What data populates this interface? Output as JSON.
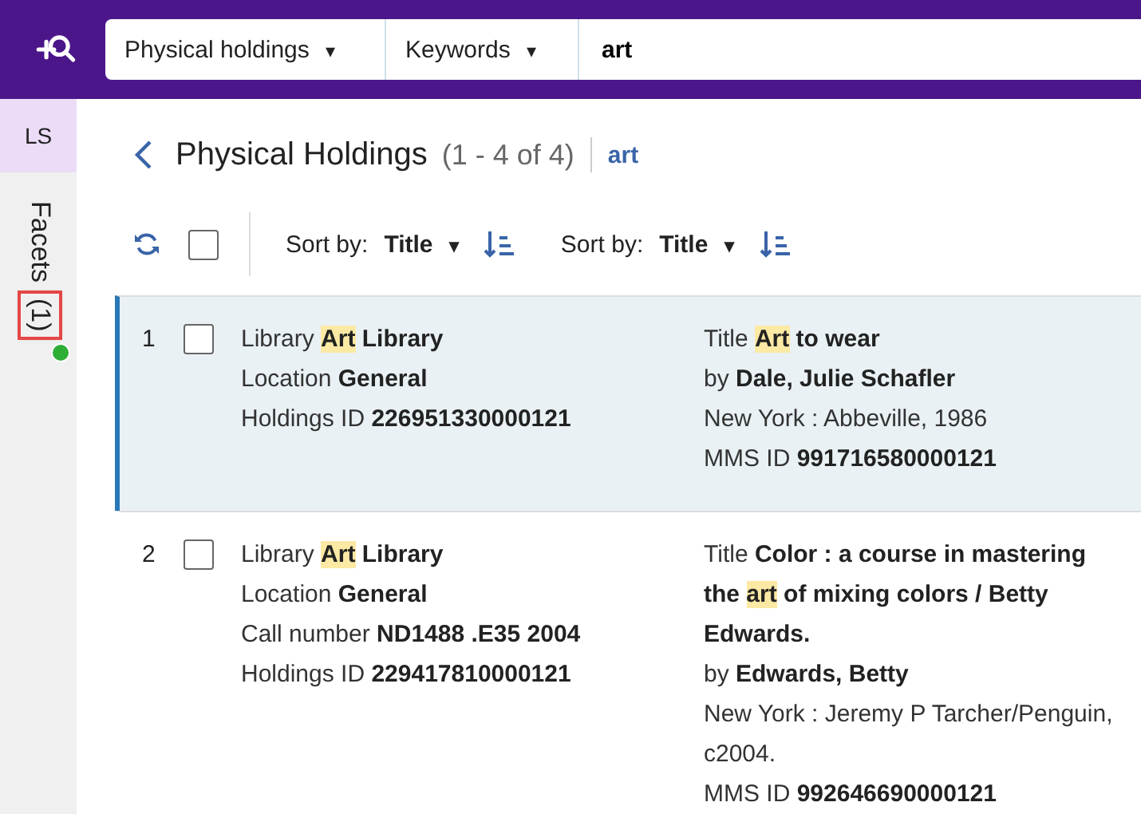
{
  "search_bar": {
    "scope": "Physical holdings",
    "scope_caret": "▾",
    "field": "Keywords",
    "field_caret": "▾",
    "query": "art"
  },
  "sidebar": {
    "tab": "LS",
    "facets": {
      "label": "Facets",
      "count": "(1)",
      "active": true,
      "highlighted": true
    }
  },
  "header": {
    "title": "Physical Holdings",
    "range": "(1 - 4 of 4)",
    "query": "art"
  },
  "toolbar": {
    "select_all": {
      "checked": false
    },
    "sorts": [
      {
        "label": "Sort by:",
        "value": "Title",
        "caret": "▾"
      },
      {
        "label": "Sort by:",
        "value": "Title",
        "caret": "▾"
      }
    ]
  },
  "results": [
    {
      "number": "1",
      "selected": true,
      "checked": false,
      "columns": [
        [
          {
            "label": "Library",
            "value": [
              {
                "text": "Art",
                "highlight": true
              },
              {
                "text": " Library"
              }
            ]
          },
          {
            "label": "Location",
            "value": [
              {
                "text": "General"
              }
            ]
          },
          {
            "label": "Holdings ID",
            "value": [
              {
                "text": "226951330000121"
              }
            ]
          }
        ],
        [
          {
            "label": "Title",
            "value": [
              {
                "text": "Art",
                "highlight": true
              },
              {
                "text": " to wear"
              }
            ]
          },
          {
            "label": "by",
            "value": [
              {
                "text": "Dale, Julie Schafler"
              }
            ]
          },
          {
            "plain": "New York : Abbeville, 1986"
          },
          {
            "label": "MMS ID",
            "value": [
              {
                "text": "991716580000121"
              }
            ]
          }
        ]
      ]
    },
    {
      "number": "2",
      "selected": false,
      "checked": false,
      "columns": [
        [
          {
            "label": "Library",
            "value": [
              {
                "text": "Art",
                "highlight": true
              },
              {
                "text": " Library"
              }
            ]
          },
          {
            "label": "Location",
            "value": [
              {
                "text": "General"
              }
            ]
          },
          {
            "label": "Call number",
            "value": [
              {
                "text": "ND1488 .E35 2004"
              }
            ]
          },
          {
            "label": "Holdings ID",
            "value": [
              {
                "text": "229417810000121"
              }
            ]
          }
        ],
        [
          {
            "label": "Title",
            "value": [
              {
                "text": "Color : a course in mastering the "
              },
              {
                "text": "art",
                "highlight": true
              },
              {
                "text": " of mixing colors / Betty Edwards."
              }
            ]
          },
          {
            "label": "by",
            "value": [
              {
                "text": "Edwards, Betty"
              }
            ]
          },
          {
            "plain": "New York : Jeremy P Tarcher/Penguin, c2004."
          },
          {
            "label": "MMS ID",
            "value": [
              {
                "text": "992646690000121"
              }
            ]
          }
        ]
      ]
    }
  ]
}
